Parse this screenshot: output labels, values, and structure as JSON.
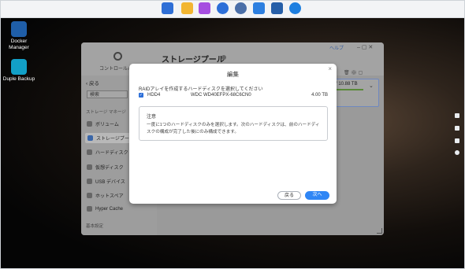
{
  "taskbar": {
    "icons": [
      {
        "name": "apps-grid-icon",
        "color": "#2f6fd6"
      },
      {
        "name": "folder-icon",
        "color": "#f2b632"
      },
      {
        "name": "media-icon",
        "color": "#a64ee0"
      },
      {
        "name": "clock-icon",
        "color": "#2d6fd8"
      },
      {
        "name": "settings-icon",
        "color": "#4b6fa8"
      },
      {
        "name": "mail-icon",
        "color": "#2d7fe0"
      },
      {
        "name": "docker-icon",
        "color": "#275fa8"
      },
      {
        "name": "support-icon",
        "color": "#1e7fe0"
      }
    ]
  },
  "desktop": {
    "docker_label_1": "Docker",
    "docker_label_2": "Manager",
    "backup_label": "Duple Backup"
  },
  "window": {
    "help": "ヘルプ",
    "panel_label": "コントロールパ",
    "title": "ストレージプール",
    "back": "戻る",
    "search_placeholder": "検索",
    "section_storage": "ストレージ マネージ",
    "section_basic": "基本設定",
    "capacity": "/ 10.88 TB",
    "sidebar": [
      {
        "label": "ボリューム"
      },
      {
        "label": "ストレージプー"
      },
      {
        "label": "ハードディスク"
      },
      {
        "label": "仮想ディスク"
      },
      {
        "label": "USB デバイス"
      },
      {
        "label": "ホットスペア"
      },
      {
        "label": "Hyper Cache"
      }
    ]
  },
  "modal": {
    "title": "編集",
    "prompt": "RAIDアレイを作成するハードディスクを選択してください",
    "disk": {
      "name": "HDD4",
      "model": "WDC WD40EFPX-68C6CN0",
      "size": "4.00 TB",
      "checked": true
    },
    "notice_title": "注意",
    "notice_text": "一度に1つのハードディスクのみを選択します。次のハードディスクは、前のハードディスクの構成が完了した後にのみ構成できます。",
    "back_button": "戻る",
    "next_button": "次へ"
  }
}
